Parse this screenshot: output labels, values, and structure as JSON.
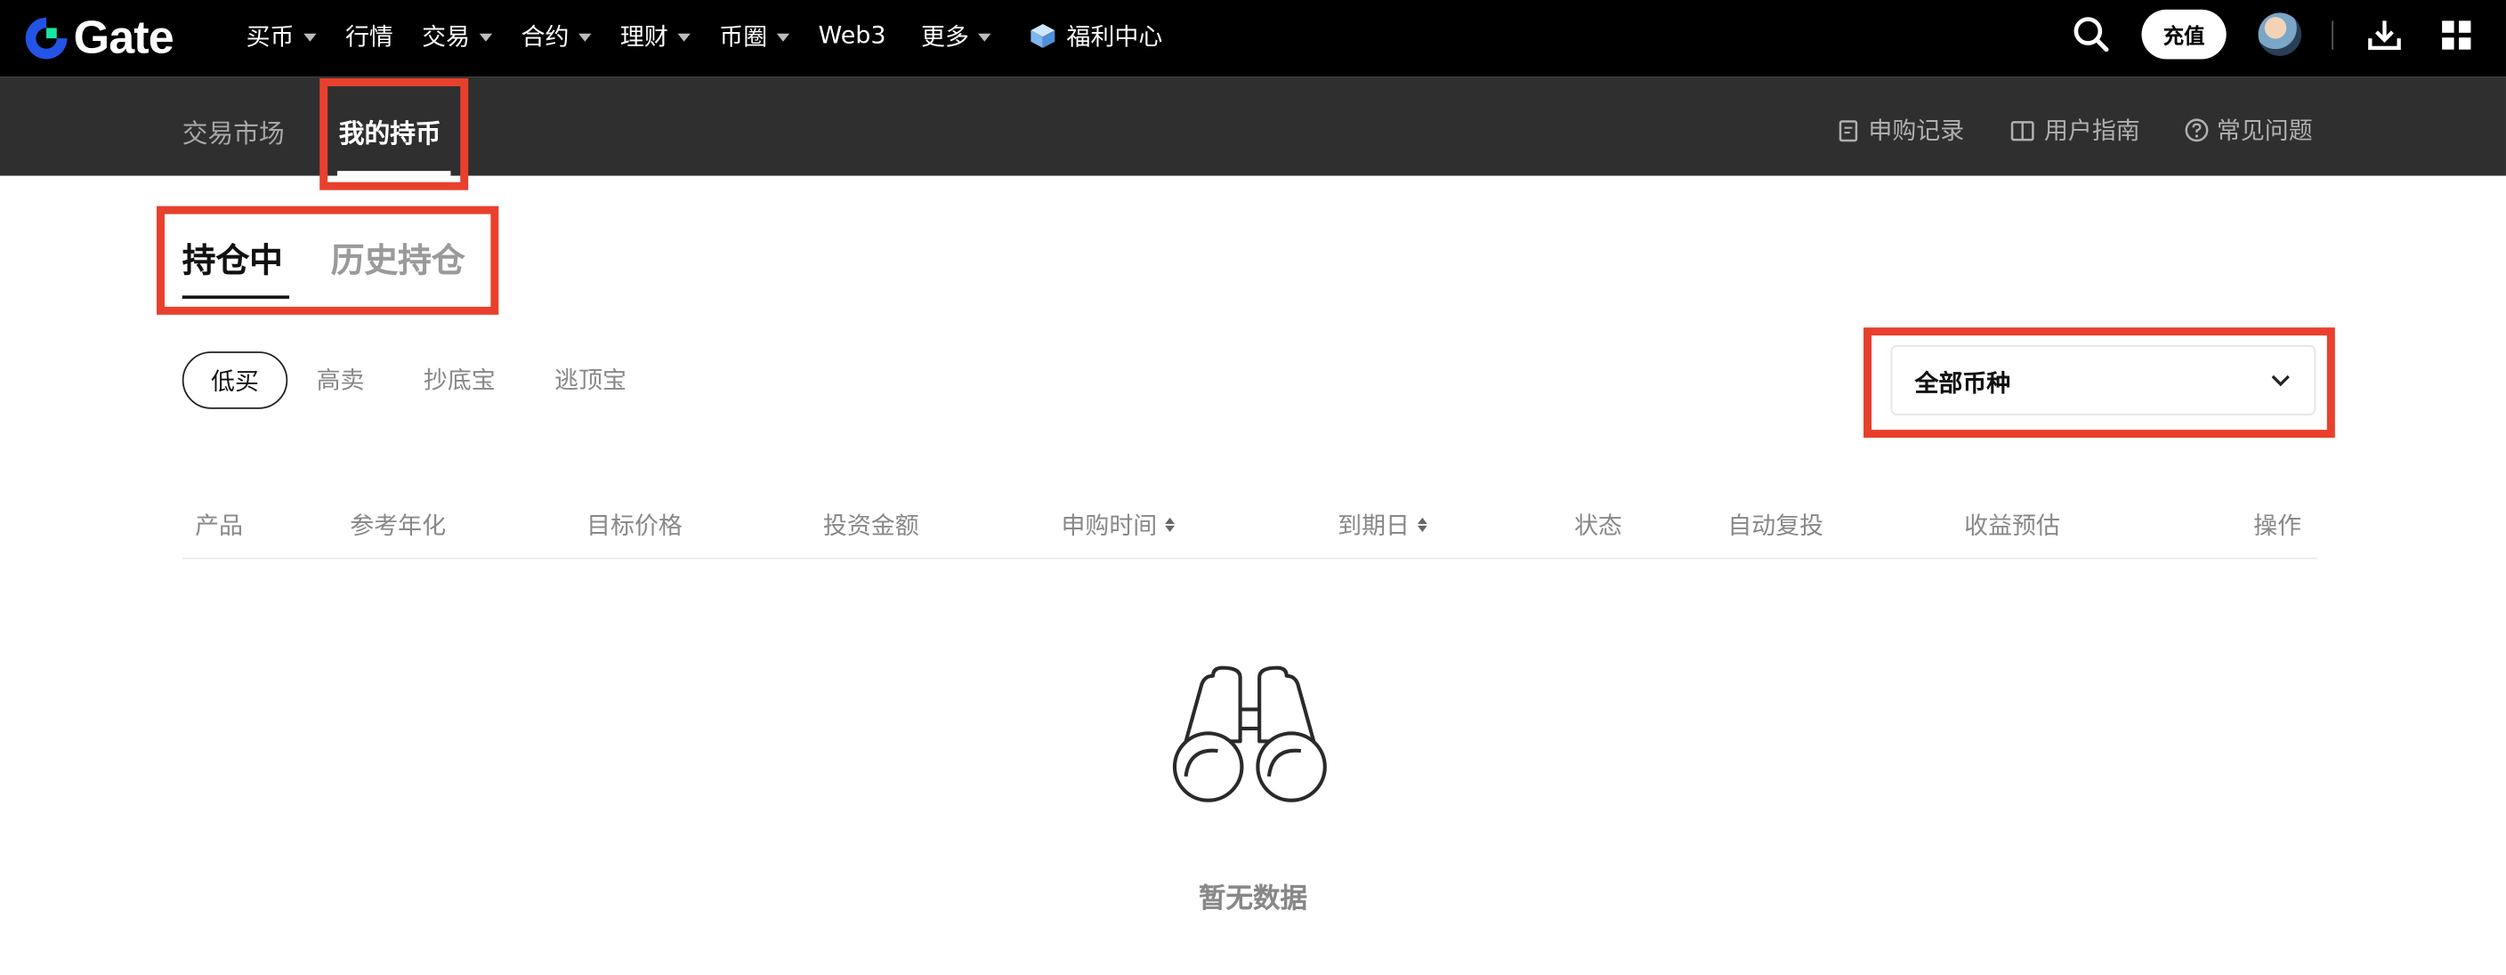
{
  "header": {
    "logo_text": "Gate",
    "nav": [
      {
        "label": "买币",
        "dropdown": true
      },
      {
        "label": "行情",
        "dropdown": false
      },
      {
        "label": "交易",
        "dropdown": true
      },
      {
        "label": "合约",
        "dropdown": true
      },
      {
        "label": "理财",
        "dropdown": true
      },
      {
        "label": "币圈",
        "dropdown": true
      },
      {
        "label": "Web3",
        "dropdown": false
      },
      {
        "label": "更多",
        "dropdown": true
      },
      {
        "label": "福利中心",
        "dropdown": false,
        "icon": "gift-cube-icon"
      }
    ],
    "deposit_label": "充值",
    "icons": [
      "search-icon",
      "avatar",
      "download-icon",
      "grid-menu-icon"
    ]
  },
  "subnav": {
    "tabs": [
      {
        "label": "交易市场",
        "active": false
      },
      {
        "label": "我的持币",
        "active": true
      }
    ],
    "links": [
      {
        "label": "申购记录",
        "icon": "record-icon"
      },
      {
        "label": "用户指南",
        "icon": "book-icon"
      },
      {
        "label": "常见问题",
        "icon": "question-icon"
      }
    ]
  },
  "main": {
    "tabs": [
      {
        "label": "持仓中",
        "active": true
      },
      {
        "label": "历史持仓",
        "active": false
      }
    ],
    "filters": [
      {
        "label": "低买",
        "selected": true
      },
      {
        "label": "高卖",
        "selected": false
      },
      {
        "label": "抄底宝",
        "selected": false
      },
      {
        "label": "逃顶宝",
        "selected": false
      }
    ],
    "coin_select": {
      "value": "全部币种"
    },
    "table": {
      "columns": [
        {
          "label": "产品",
          "sortable": false
        },
        {
          "label": "参考年化",
          "sortable": false
        },
        {
          "label": "目标价格",
          "sortable": false
        },
        {
          "label": "投资金额",
          "sortable": false
        },
        {
          "label": "申购时间",
          "sortable": true
        },
        {
          "label": "到期日",
          "sortable": true
        },
        {
          "label": "状态",
          "sortable": false
        },
        {
          "label": "自动复投",
          "sortable": false
        },
        {
          "label": "收益预估",
          "sortable": false
        },
        {
          "label": "操作",
          "sortable": false
        }
      ],
      "rows": []
    },
    "empty": {
      "text": "暂无数据",
      "icon": "binoculars-icon"
    }
  },
  "colors": {
    "highlight": "#e8402c",
    "logo_blue": "#2354e6",
    "logo_green": "#17e6a1"
  }
}
